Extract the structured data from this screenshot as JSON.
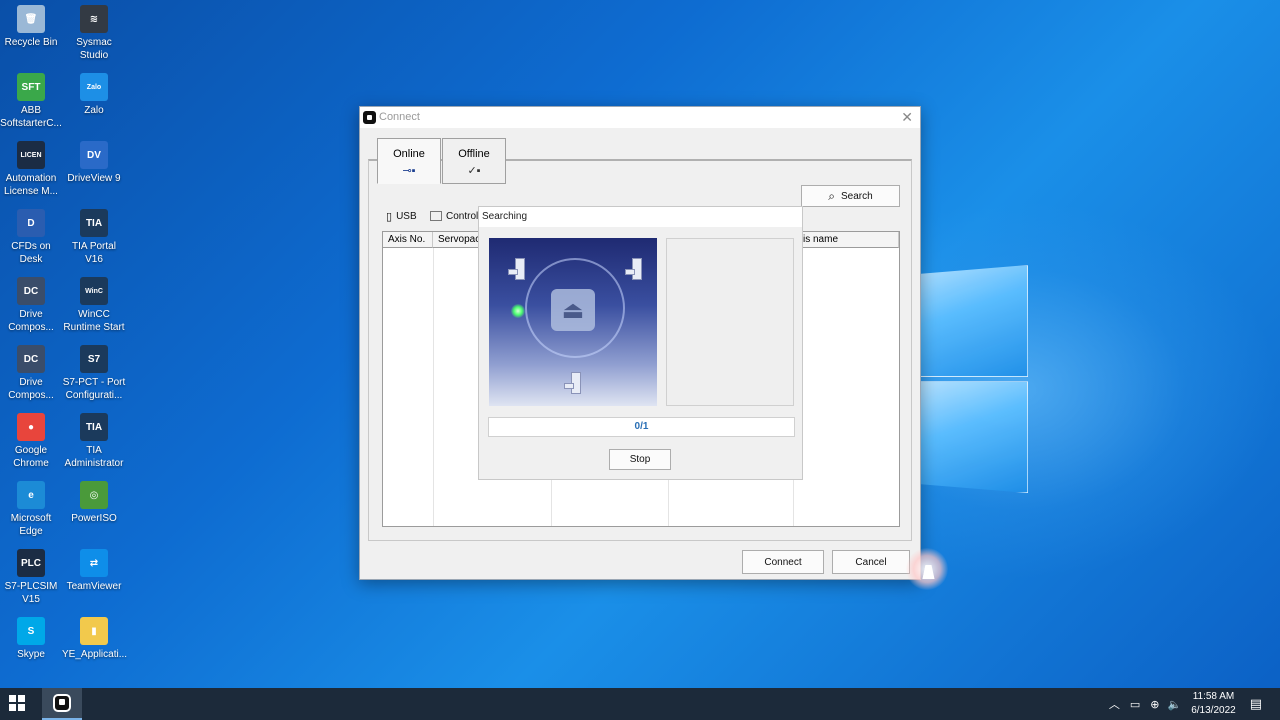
{
  "desktop": {
    "icons_col1": [
      {
        "label": "Recycle Bin",
        "icon": "recycle-bin-icon",
        "glyph": "🗑",
        "color": "#9ab8d6"
      },
      {
        "label": "ABB SoftstarterC...",
        "icon": "abb-softstarter-icon",
        "glyph": "SFT",
        "color": "#3aa84a"
      },
      {
        "label": "Automation License M...",
        "icon": "automation-license-icon",
        "glyph": "LICEN",
        "color": "#1b2c44"
      },
      {
        "label": "CFDs on Desk",
        "icon": "cfds-icon",
        "glyph": "D",
        "color": "#2a5db0"
      },
      {
        "label": "Drive Compos...",
        "icon": "drive-composer-icon",
        "glyph": "DC",
        "color": "#3a4d6a"
      },
      {
        "label": "Drive Compos...",
        "icon": "drive-composer-icon-2",
        "glyph": "DC",
        "color": "#3a4d6a"
      },
      {
        "label": "Google Chrome",
        "icon": "chrome-icon",
        "glyph": "●",
        "color": "#e8453c"
      },
      {
        "label": "Microsoft Edge",
        "icon": "edge-icon",
        "glyph": "e",
        "color": "#1c8bd6"
      },
      {
        "label": "S7-PLCSIM V15",
        "icon": "plcsim-icon",
        "glyph": "PLC",
        "color": "#1b2c44"
      },
      {
        "label": "Skype",
        "icon": "skype-icon",
        "glyph": "S",
        "color": "#00a8e8"
      }
    ],
    "icons_col2": [
      {
        "label": "Sysmac Studio",
        "icon": "sysmac-studio-icon",
        "glyph": "≋",
        "color": "#333a44"
      },
      {
        "label": "Zalo",
        "icon": "zalo-icon",
        "glyph": "Zalo",
        "color": "#1d8fe6"
      },
      {
        "label": "DriveView 9",
        "icon": "driveview-icon",
        "glyph": "DV",
        "color": "#2a6ac8"
      },
      {
        "label": "TIA Portal V16",
        "icon": "tia-portal-icon",
        "glyph": "TIA",
        "color": "#1b3a5c"
      },
      {
        "label": "WinCC Runtime Start",
        "icon": "wincc-icon",
        "glyph": "WinC",
        "color": "#1b3a5c"
      },
      {
        "label": "S7-PCT - Port Configurati...",
        "icon": "s7pct-icon",
        "glyph": "S7",
        "color": "#1b3a5c"
      },
      {
        "label": "TIA Administrator",
        "icon": "tia-admin-icon",
        "glyph": "TIA",
        "color": "#1b3a5c"
      },
      {
        "label": "PowerISO",
        "icon": "poweriso-icon",
        "glyph": "◎",
        "color": "#4a9a3a"
      },
      {
        "label": "TeamViewer",
        "icon": "teamviewer-icon",
        "glyph": "⇄",
        "color": "#0e8ee9"
      },
      {
        "label": "YE_Applicati...",
        "icon": "folder-icon",
        "glyph": "▮",
        "color": "#f2c94c"
      }
    ]
  },
  "dialog": {
    "title": "Connect",
    "tabs": [
      {
        "label": "Online",
        "icon": "online-icon",
        "glyph": "◂▪"
      },
      {
        "label": "Offline",
        "icon": "offline-icon",
        "glyph": "◂▪"
      }
    ],
    "search_label": "Search",
    "subtabs": [
      {
        "label": "USB",
        "icon": "usb-icon"
      },
      {
        "label": "Controll",
        "icon": "controller-icon"
      }
    ],
    "columns": [
      "Axis No.",
      "Servopac",
      "",
      "xis name"
    ],
    "connect_label": "Connect",
    "cancel_label": "Cancel"
  },
  "searching": {
    "title": "Searching",
    "progress": "0/1",
    "stop_label": "Stop"
  },
  "taskbar": {
    "time": "11:58 AM",
    "date": "6/13/2022"
  }
}
